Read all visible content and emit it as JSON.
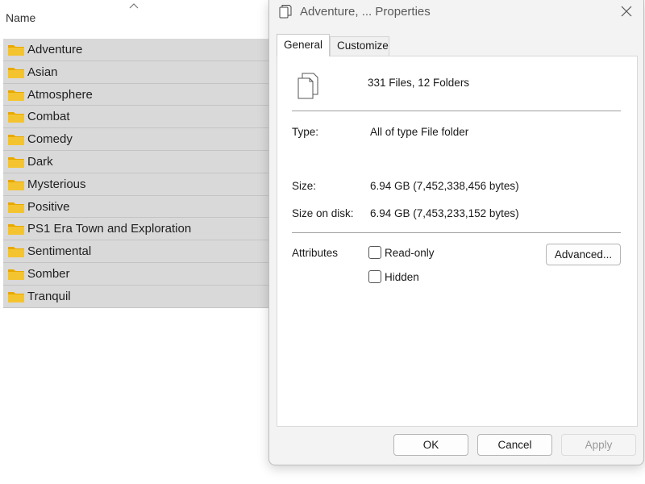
{
  "explorer": {
    "column_header": "Name",
    "items": [
      {
        "label": "Adventure"
      },
      {
        "label": "Asian"
      },
      {
        "label": "Atmosphere"
      },
      {
        "label": "Combat"
      },
      {
        "label": "Comedy"
      },
      {
        "label": "Dark"
      },
      {
        "label": "Mysterious"
      },
      {
        "label": "Positive"
      },
      {
        "label": "PS1 Era Town and Exploration"
      },
      {
        "label": "Sentimental"
      },
      {
        "label": "Somber"
      },
      {
        "label": "Tranquil"
      }
    ]
  },
  "dialog": {
    "title": "Adventure, ... Properties",
    "tabs": [
      {
        "label": "General",
        "active": true
      },
      {
        "label": "Customize",
        "active": false
      }
    ],
    "summary": "331 Files, 12 Folders",
    "type_label": "Type:",
    "type_value": "All of type File folder",
    "size_label": "Size:",
    "size_value": "6.94 GB (7,452,338,456 bytes)",
    "size_on_disk_label": "Size on disk:",
    "size_on_disk_value": "6.94 GB (7,453,233,152 bytes)",
    "attributes_label": "Attributes",
    "readonly_label": "Read-only",
    "hidden_label": "Hidden",
    "advanced_label": "Advanced...",
    "ok_label": "OK",
    "cancel_label": "Cancel",
    "apply_label": "Apply"
  },
  "colors": {
    "folder": "#f4c430",
    "selection": "#d9d9d9",
    "dialog_bg": "#f3f3f3"
  }
}
